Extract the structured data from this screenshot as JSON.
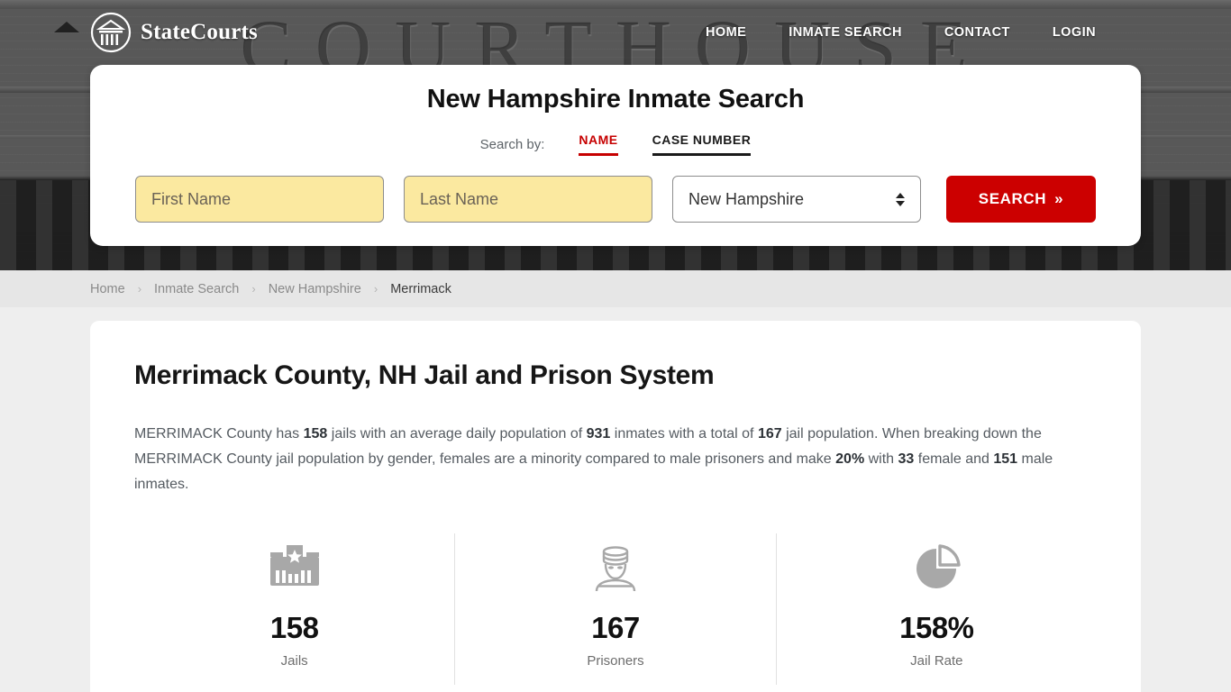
{
  "header": {
    "brand_name": "StateCourts",
    "logo_icon": "courthouse-circle-logo",
    "nav": [
      {
        "label": "HOME"
      },
      {
        "label": "INMATE SEARCH"
      },
      {
        "label": "CONTACT"
      },
      {
        "label": "LOGIN"
      }
    ]
  },
  "search_card": {
    "title": "New Hampshire Inmate Search",
    "search_by_label": "Search by:",
    "tabs": [
      {
        "label": "NAME",
        "active": true
      },
      {
        "label": "CASE NUMBER",
        "active": false
      }
    ],
    "first_name": {
      "value": "",
      "placeholder": "First Name"
    },
    "last_name": {
      "value": "",
      "placeholder": "Last Name"
    },
    "state_select": {
      "value": "New Hampshire",
      "icon": "select-spinner-icon"
    },
    "search_button": {
      "label": "SEARCH",
      "icon": "double-chevron-right-icon",
      "color": "#cc0000"
    }
  },
  "breadcrumb": {
    "items": [
      {
        "label": "Home",
        "current": false
      },
      {
        "label": "Inmate Search",
        "current": false
      },
      {
        "label": "New Hampshire",
        "current": false
      },
      {
        "label": "Merrimack",
        "current": true
      }
    ],
    "separator": "›"
  },
  "main": {
    "page_title": "Merrimack County, NH Jail and Prison System",
    "intro": {
      "p1": "MERRIMACK County has ",
      "b1": "158",
      "p2": " jails with an average daily population of ",
      "b2": "931",
      "p3": " inmates with a total of ",
      "b3": "167",
      "p4": " jail population. When breaking down the MERRIMACK County jail population by gender, females are a minority compared to male prisoners and make ",
      "b4": "20%",
      "p5": " with ",
      "b5": "33",
      "p6": " female and ",
      "b6": "151",
      "p7": " male inmates."
    },
    "stats": [
      {
        "icon": "jail-building-icon",
        "value": "158",
        "label": "Jails"
      },
      {
        "icon": "prisoner-icon",
        "value": "167",
        "label": "Prisoners"
      },
      {
        "icon": "pie-chart-icon",
        "value": "158%",
        "label": "Jail Rate"
      }
    ]
  },
  "hero": {
    "background_text": "COURTHOUSE"
  }
}
